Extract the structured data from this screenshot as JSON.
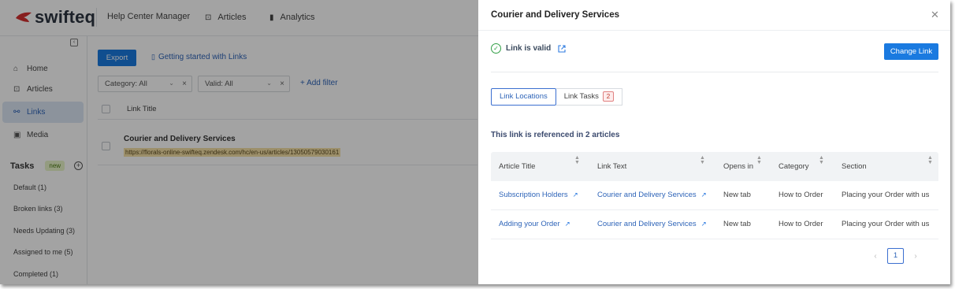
{
  "app": {
    "brand": "swifteq",
    "title": "Help Center Manager",
    "nav": {
      "articles": "Articles",
      "analytics": "Analytics"
    }
  },
  "sidebar": {
    "items": [
      {
        "label": "Home",
        "icon": "home-icon"
      },
      {
        "label": "Articles",
        "icon": "article-icon"
      },
      {
        "label": "Links",
        "icon": "link-icon",
        "active": true
      },
      {
        "label": "Media",
        "icon": "media-icon"
      }
    ],
    "tasks_label": "Tasks",
    "tasks_badge": "new",
    "tasks": [
      "Default (1)",
      "Broken links (3)",
      "Needs Updating (3)",
      "Assigned to me (5)",
      "Completed (1)"
    ]
  },
  "main": {
    "export_label": "Export",
    "getting_started": "Getting started with Links",
    "filters": [
      {
        "label": "Category: All"
      },
      {
        "label": "Valid: All"
      }
    ],
    "add_filter": "+ Add filter",
    "column_header": "Link Title",
    "rows": [
      {
        "title": "Courier and Delivery Services",
        "url": "https://florals-online-swifteq.zendesk.com/hc/en-us/articles/13050579030161"
      }
    ]
  },
  "drawer": {
    "title": "Courier and Delivery Services",
    "status": "Link is valid",
    "change_link": "Change Link",
    "tabs": [
      {
        "label": "Link Locations",
        "active": true
      },
      {
        "label": "Link Tasks",
        "badge": "2"
      }
    ],
    "ref_text": "This link is referenced in 2 articles",
    "columns": [
      "Article Title",
      "Link Text",
      "Opens in",
      "Category",
      "Section"
    ],
    "rows": [
      {
        "article": "Subscription Holders",
        "link_text": "Courier and Delivery Services",
        "opens_in": "New tab",
        "category": "How to Order",
        "section": "Placing your Order with us"
      },
      {
        "article": "Adding your Order",
        "link_text": "Courier and Delivery Services",
        "opens_in": "New tab",
        "category": "How to Order",
        "section": "Placing your Order with us"
      }
    ],
    "page": "1"
  },
  "colors": {
    "accent": "#1a7ae0",
    "valid": "#2f9e44",
    "badge": "#c0392b",
    "brand": "#d32f2f"
  }
}
